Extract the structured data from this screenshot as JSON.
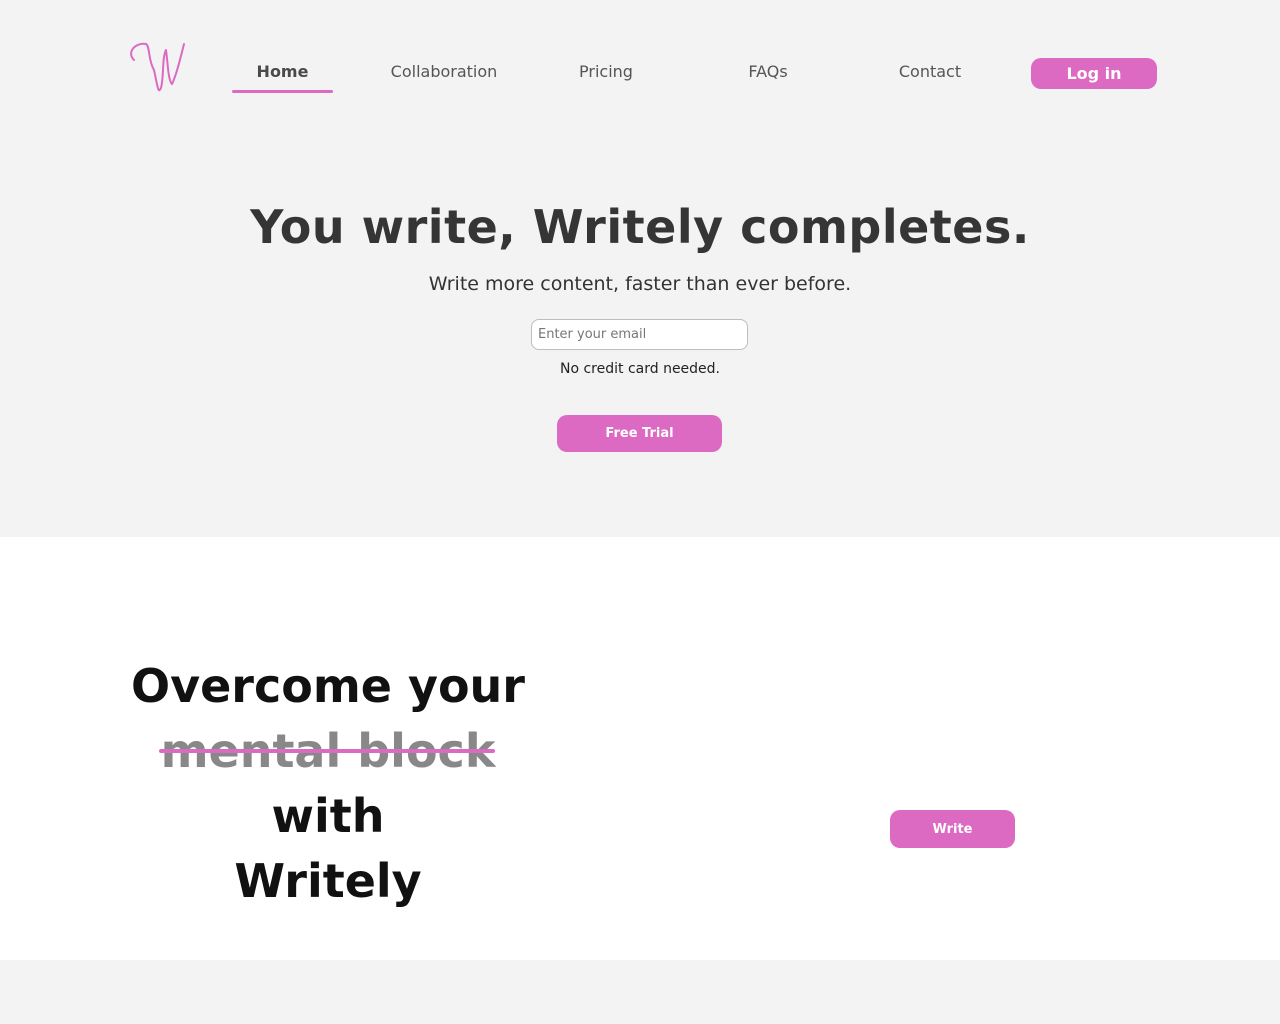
{
  "header": {
    "logo_icon": "script-w-logo",
    "nav": [
      {
        "label": "Home",
        "active": true
      },
      {
        "label": "Collaboration",
        "active": false
      },
      {
        "label": "Pricing",
        "active": false
      },
      {
        "label": "FAQs",
        "active": false
      },
      {
        "label": "Contact",
        "active": false
      }
    ],
    "login_label": "Log in"
  },
  "hero": {
    "title": "You write, Writely completes.",
    "subtitle": "Write more content, faster than ever before.",
    "email_placeholder": "Enter your email",
    "email_value": "",
    "note": "No credit card needed.",
    "cta_label": "Free Trial"
  },
  "feature": {
    "headline_start": "Overcome your",
    "headline_struck": "mental block",
    "headline_middle": "with",
    "headline_end": "Writely",
    "write_label": "Write"
  },
  "colors": {
    "accent": "#dc6ac2",
    "background": "#f3f3f3",
    "section": "#ffffff"
  }
}
